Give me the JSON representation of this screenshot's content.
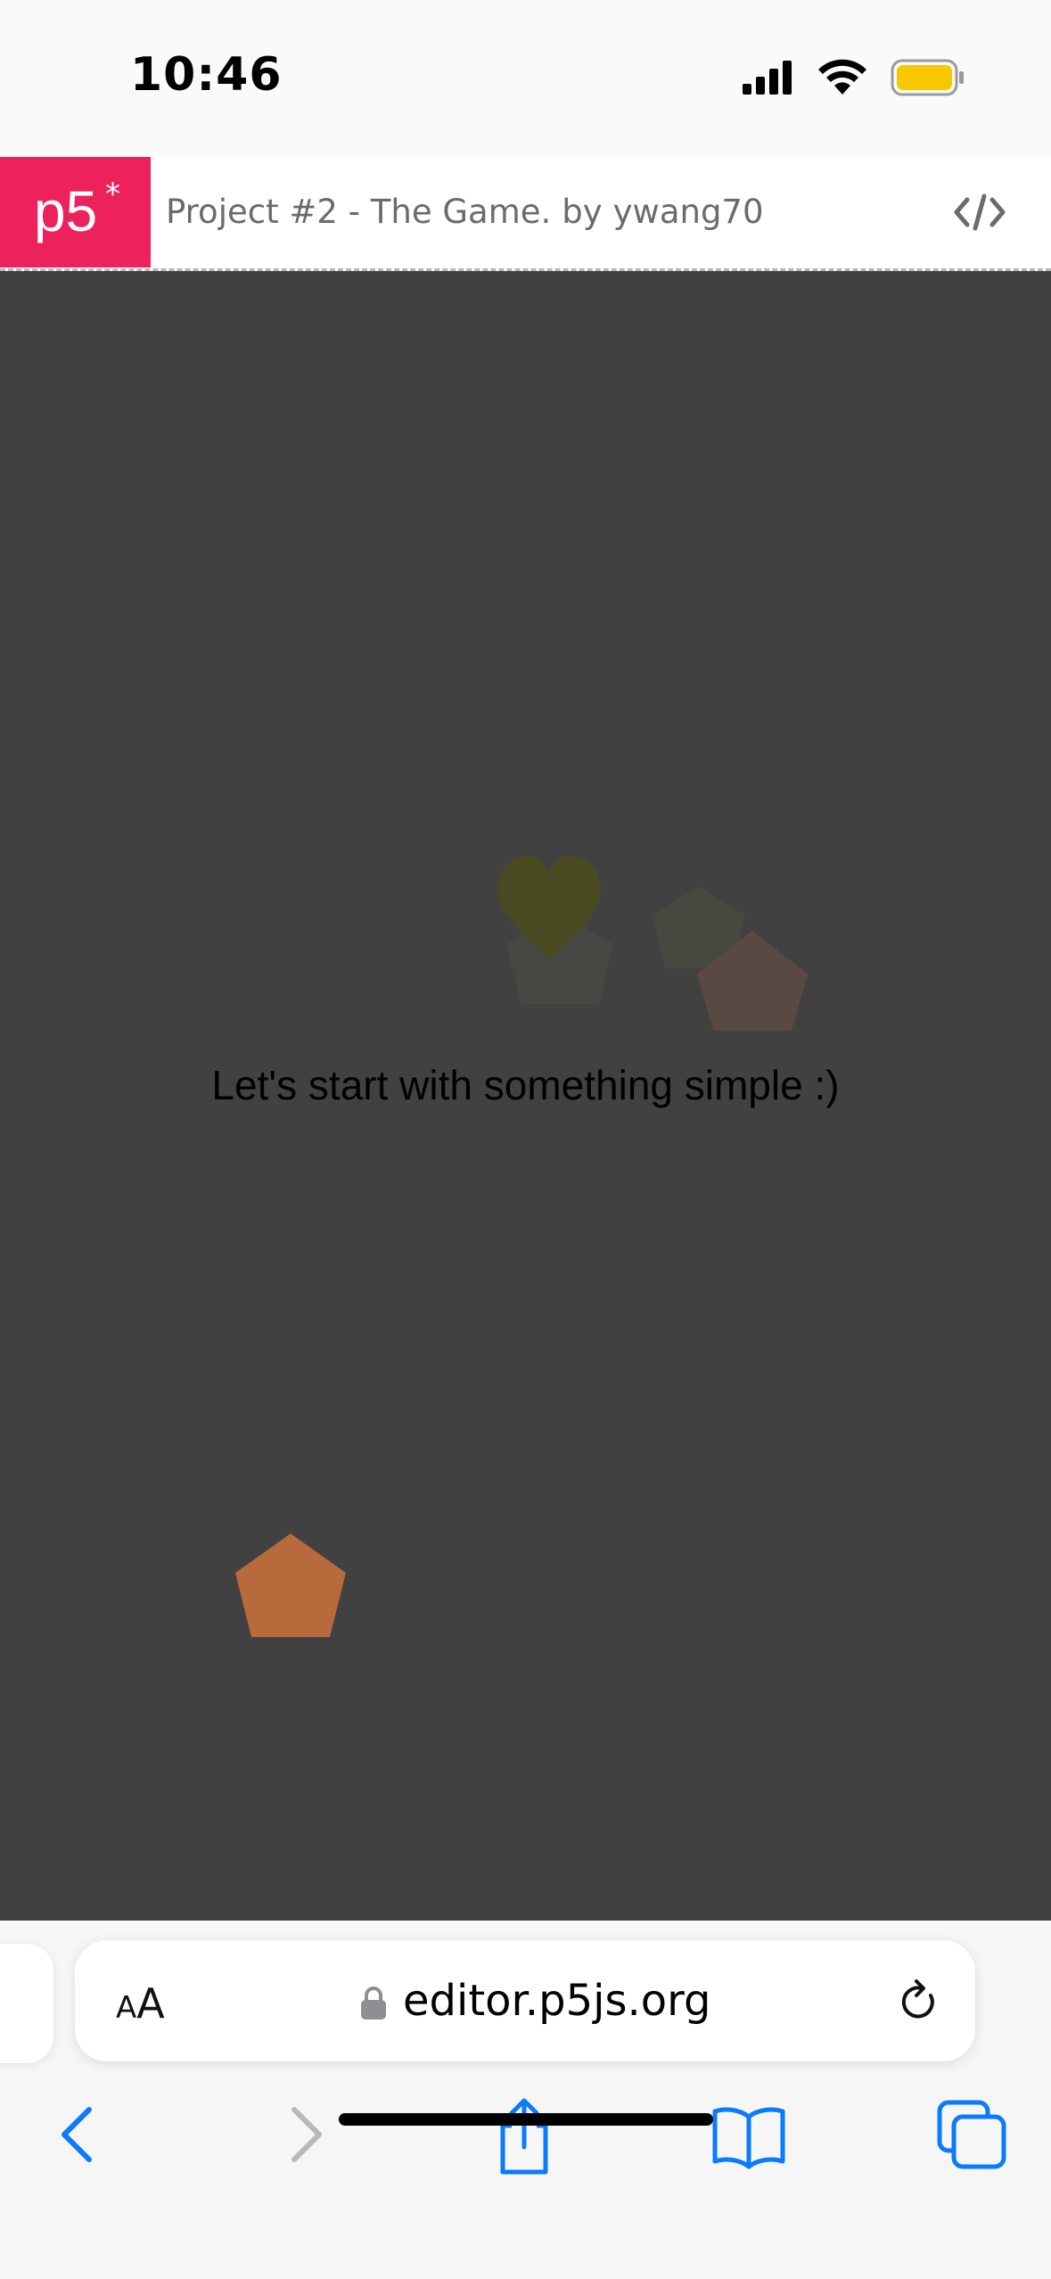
{
  "status_bar": {
    "time": "10:46",
    "icons": [
      "signal-icon",
      "wifi-icon",
      "battery-icon"
    ],
    "battery_color": "#f7c800"
  },
  "p5_header": {
    "logo_text": "p5",
    "logo_star": "*",
    "project_title": "Project #2 - The Game.",
    "by_label": "by",
    "author": "ywang70",
    "code_icon": "code-icon",
    "brand_color": "#ed225d"
  },
  "canvas": {
    "background": "#414141",
    "message": "Let's start with something simple :)",
    "shapes": [
      {
        "name": "heart",
        "color": "#4a4a22"
      },
      {
        "name": "pentagon-faded-green",
        "color": "#464843"
      },
      {
        "name": "pentagon-faded-olive",
        "color": "#474840"
      },
      {
        "name": "pentagon-faded-orange",
        "color": "#5a4842"
      },
      {
        "name": "pentagon-orange",
        "color": "#b86a3c"
      }
    ]
  },
  "safari": {
    "reader_label_small": "A",
    "reader_label_big": "A",
    "url": "editor.p5js.org",
    "accent_color": "#0a7aff",
    "nav_icons": [
      "back-icon",
      "forward-icon",
      "share-icon",
      "bookmarks-icon",
      "tabs-icon"
    ]
  }
}
